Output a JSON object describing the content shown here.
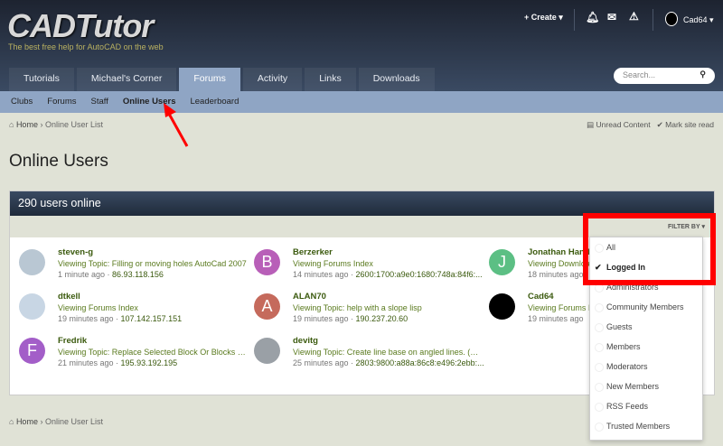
{
  "header": {
    "logo": "CADTutor",
    "tagline": "The best free help for AutoCAD on the web",
    "create": "Create",
    "user": "Cad64",
    "icons": [
      "bell-icon",
      "envelope-icon",
      "warning-icon"
    ]
  },
  "nav": {
    "tabs": [
      "Tutorials",
      "Michael's Corner",
      "Forums",
      "Activity",
      "Links",
      "Downloads"
    ],
    "active": "Forums",
    "search_placeholder": "Search..."
  },
  "subnav": {
    "items": [
      "Clubs",
      "Forums",
      "Staff",
      "Online Users",
      "Leaderboard"
    ],
    "active": "Online Users"
  },
  "breadcrumb": {
    "home": "Home",
    "current": "Online User List",
    "unread": "Unread Content",
    "mark_read": "Mark site read"
  },
  "page_title": "Online Users",
  "box": {
    "title": "290 users online",
    "filter_label": "FILTER BY"
  },
  "users": [
    {
      "name": "steven-g",
      "activity": "Viewing Topic: Filling or moving holes AutoCad 2007",
      "time": "1 minute ago",
      "ip": "86.93.118.156",
      "letter": "",
      "color": "#b9c7d3"
    },
    {
      "name": "Berzerker",
      "activity": "Viewing Forums Index",
      "time": "14 minutes ago",
      "ip": "2600:1700:a9e0:1680:748a:84f6:...",
      "letter": "B",
      "color": "#b85fb8"
    },
    {
      "name": "Jonathan Handojo",
      "activity": "Viewing Downloads",
      "time": "18 minutes ago",
      "ip": "",
      "letter": "J",
      "color": "#5cbf84"
    },
    {
      "name": "dtkell",
      "activity": "Viewing Forums Index",
      "time": "19 minutes ago",
      "ip": "107.142.157.151",
      "letter": "",
      "color": "#c8d6e4"
    },
    {
      "name": "ALAN70",
      "activity": "Viewing Topic: help with a slope lisp",
      "time": "19 minutes ago",
      "ip": "190.237.20.60",
      "letter": "A",
      "color": "#c56a5c"
    },
    {
      "name": "Cad64",
      "activity": "Viewing Forums Index",
      "time": "19 minutes ago",
      "ip": "",
      "letter": "",
      "color": "#000000"
    },
    {
      "name": "Fredrik",
      "activity": "Viewing Topic: Replace Selected Block Or Blocks Wi...",
      "time": "21 minutes ago",
      "ip": "195.93.192.195",
      "letter": "F",
      "color": "#a35ec8"
    },
    {
      "name": "devitg",
      "activity": "Viewing Topic: Create line base on angled lines. (no...",
      "time": "25 minutes ago",
      "ip": "2803:9800:a88a:86c8:e496:2ebb:...",
      "letter": "",
      "color": "#9aa0a6"
    }
  ],
  "filter_options": [
    "All",
    "Logged In",
    "Administrators",
    "Community Members",
    "Guests",
    "Members",
    "Moderators",
    "New Members",
    "RSS Feeds",
    "Trusted Members"
  ],
  "filter_selected": "Logged In",
  "colors": {
    "highlight": "#ff0000",
    "subnav": "#8fa5c4",
    "link": "#3b5a0e"
  }
}
